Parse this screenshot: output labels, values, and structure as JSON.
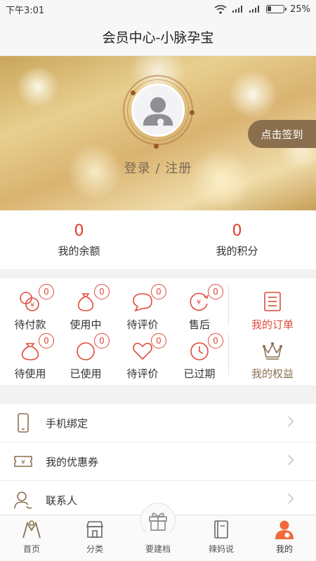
{
  "status": {
    "time": "下午3:01",
    "battery": "25%"
  },
  "header": {
    "title": "会员中心-小脉孕宝"
  },
  "profile": {
    "login_text": "登录 / 注册",
    "checkin_label": "点击签到",
    "avatar_icon": "user-avatar-icon"
  },
  "stats": [
    {
      "value": "0",
      "label": "我的余额"
    },
    {
      "value": "0",
      "label": "我的积分"
    }
  ],
  "orders": {
    "row1": [
      {
        "label": "待付款",
        "count": "0",
        "icon": "wallet-coins-icon"
      },
      {
        "label": "使用中",
        "count": "0",
        "icon": "money-bag-icon"
      },
      {
        "label": "待评价",
        "count": "0",
        "icon": "chat-bubble-icon"
      },
      {
        "label": "售后",
        "count": "0",
        "icon": "refund-icon"
      }
    ],
    "row2": [
      {
        "label": "待使用",
        "count": "0",
        "icon": "gift-bag-icon"
      },
      {
        "label": "已使用",
        "count": "0",
        "icon": "circle-icon"
      },
      {
        "label": "待评价",
        "count": "0",
        "icon": "heart-icon"
      },
      {
        "label": "已过期",
        "count": "0",
        "icon": "clock-icon"
      }
    ],
    "my_orders": {
      "label": "我的订单",
      "icon": "order-list-icon",
      "color": "#e04b3a"
    },
    "my_rights": {
      "label": "我的权益",
      "icon": "crown-icon",
      "color": "#8a6f4f"
    }
  },
  "menu": [
    {
      "label": "手机绑定",
      "icon": "phone-icon"
    },
    {
      "label": "我的优惠券",
      "icon": "coupon-icon"
    },
    {
      "label": "联系人",
      "icon": "contact-icon"
    }
  ],
  "tabs": [
    {
      "label": "首页",
      "icon": "home-icon"
    },
    {
      "label": "分类",
      "icon": "store-icon"
    },
    {
      "label": "要建档",
      "icon": "gift-icon"
    },
    {
      "label": "辣妈说",
      "icon": "book-icon"
    },
    {
      "label": "我的",
      "icon": "user-icon"
    }
  ],
  "colors": {
    "accent_red": "#e04b3a",
    "accent_orange": "#f06a3a",
    "brand_brown": "#8a6f4f"
  }
}
